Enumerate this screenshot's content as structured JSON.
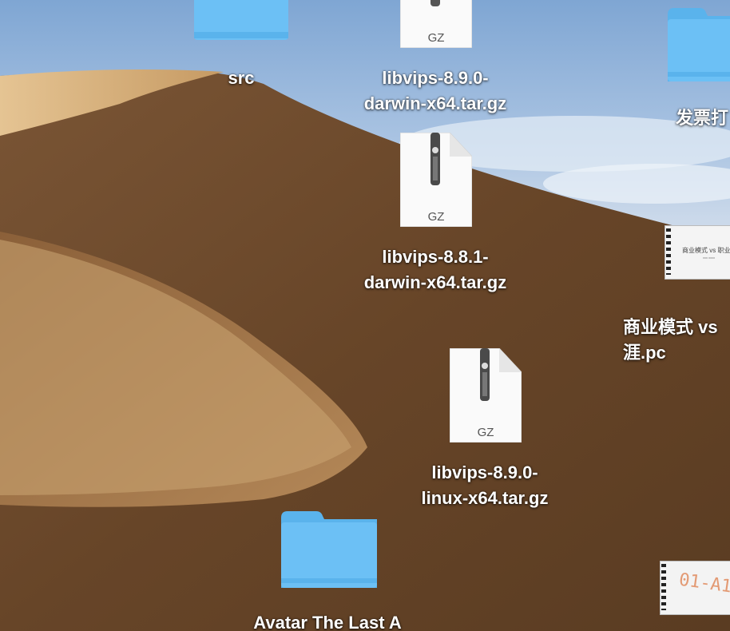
{
  "desktop": {
    "items": [
      {
        "name": "src",
        "type": "folder"
      },
      {
        "name": "libvips-8.9.0-\ndarwin-x64.tar.gz",
        "type": "archive",
        "badge": "GZ"
      },
      {
        "name": "发票打",
        "type": "folder"
      },
      {
        "name": "libvips-8.8.1-\ndarwin-x64.tar.gz",
        "type": "archive",
        "badge": "GZ"
      },
      {
        "name": "商业模式 vs\n涯.pc",
        "type": "document",
        "preview_title": "商业模式 vs 职业",
        "preview_sub": "xxx xxxx"
      },
      {
        "name": "libvips-8.9.0-\nlinux-x64.tar.gz",
        "type": "archive",
        "badge": "GZ"
      },
      {
        "name": "Avatar The Last A",
        "type": "folder"
      },
      {
        "name": "",
        "type": "document",
        "preview_stamp": "01-A1"
      }
    ]
  },
  "colors": {
    "folder": "#6cc0f5",
    "folder_tab": "#5ab3ec",
    "sky": "#a9c3e2",
    "dune_dark": "#5f4229",
    "dune_light": "#d9b27c"
  }
}
